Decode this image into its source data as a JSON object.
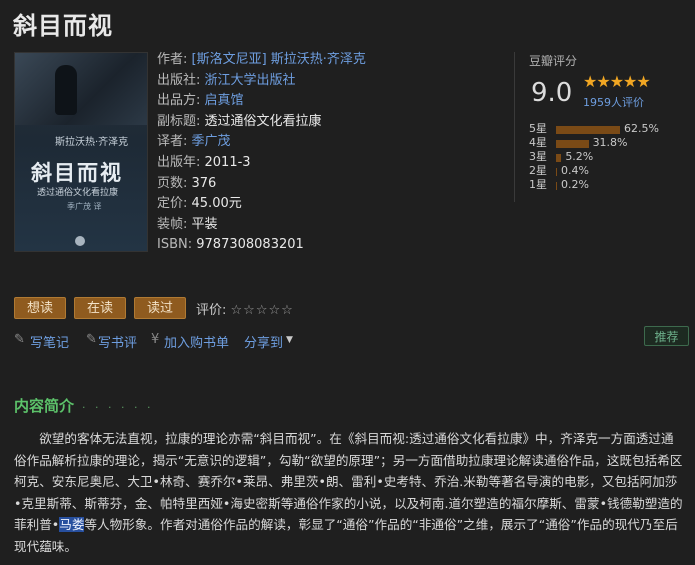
{
  "page": {
    "title": "斜目而视"
  },
  "cover": {
    "author": "斯拉沃热·齐泽克",
    "title": "斜目而视",
    "subtitle": "透过通俗文化看拉康",
    "translator": "季广茂 译"
  },
  "meta": {
    "author_label": "作者: ",
    "author_value": "[斯洛文尼亚] 斯拉沃热·齐泽克",
    "publisher_label": "出版社: ",
    "publisher_value": "浙江大学出版社",
    "producer_label": "出品方: ",
    "producer_value": "启真馆",
    "subtitle_label": "副标题: ",
    "subtitle_value": "透过通俗文化看拉康",
    "translator_label": "译者: ",
    "translator_value": "季广茂",
    "year_label": "出版年: ",
    "year_value": "2011-3",
    "pages_label": "页数: ",
    "pages_value": "376",
    "price_label": "定价: ",
    "price_value": "45.00元",
    "binding_label": "装帧: ",
    "binding_value": "平装",
    "isbn_label": "ISBN: ",
    "isbn_value": "9787308083201"
  },
  "rating": {
    "title": "豆瓣评分",
    "score": "9.0",
    "stars": "★★★★★",
    "stars_value": 4.5,
    "count": "1959人评价",
    "distribution": [
      {
        "label": "5星",
        "percent": "62.5%",
        "value": 62.5
      },
      {
        "label": "4星",
        "percent": "31.8%",
        "value": 31.8
      },
      {
        "label": "3星",
        "percent": "5.2%",
        "value": 5.2
      },
      {
        "label": "2星",
        "percent": "0.4%",
        "value": 0.4
      },
      {
        "label": "1星",
        "percent": "0.2%",
        "value": 0.2
      }
    ]
  },
  "buttons": {
    "want": "想读",
    "reading": "在读",
    "read": "读过"
  },
  "user_rating": {
    "label": "评价: ",
    "stars": "☆☆☆☆☆"
  },
  "actions": {
    "note": "写笔记",
    "review": "写书评",
    "cart": "加入购书单",
    "share": "分享到",
    "recommend": "推荐"
  },
  "section": {
    "title": "内容简介",
    "dots": "· · · · · ·"
  },
  "intro": {
    "before": "欲望的客体无法直视，拉康的理论亦需“斜目而视”。在《斜目而视:透过通俗文化看拉康》中，齐泽克一方面透过通俗作品解析拉康的理论，揭示“无意识的逻辑”，勾勒“欲望的原理”；另一方面借助拉康理论解读通俗作品，这既包括希区柯克、安东尼奥尼、大卫•林奇、赛乔尔•莱昂、弗里茨•朗、雷利•史考特、乔治.米勒等著名导演的电影，又包括阿加莎•克里斯蒂、斯蒂芬，金、帕特里西娅•海史密斯等通俗作家的小说，以及柯南.道尔塑造的福尔摩斯、雷蒙•钱德勒塑造的菲利普•",
    "highlight": "马娄",
    "after": "等人物形象。作者对通俗作品的解读，彰显了“通俗”作品的“非通俗”之维，展示了“通俗”作品的现代乃至后现代蕴味。"
  },
  "colors": {
    "accent": "#8f5b1f",
    "link": "#6e9ee0",
    "section": "#5cc26a",
    "star": "#f0a623"
  }
}
